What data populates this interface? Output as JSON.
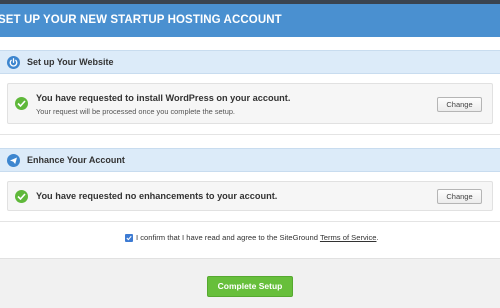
{
  "header": {
    "title": "SET UP YOUR NEW STARTUP HOSTING ACCOUNT"
  },
  "website_section": {
    "title": "Set up Your Website",
    "icon": "power-icon",
    "main_text": "You have requested to install WordPress on your account.",
    "sub_text": "Your request will be processed once you complete the setup.",
    "change_label": "Change"
  },
  "enhance_section": {
    "title": "Enhance Your Account",
    "icon": "paper-plane-icon",
    "main_text": "You have requested no enhancements to your account.",
    "change_label": "Change"
  },
  "tos": {
    "checked": true,
    "text": "I confirm that I have read and agree to the SiteGround",
    "link_text": "Terms of Service",
    "period": "."
  },
  "complete_button": {
    "label": "Complete Setup"
  },
  "colors": {
    "header_bg": "#4a90d0",
    "section_bar_bg": "#dcebf9",
    "check_green": "#5fb83a",
    "button_green": "#67bf3b"
  }
}
